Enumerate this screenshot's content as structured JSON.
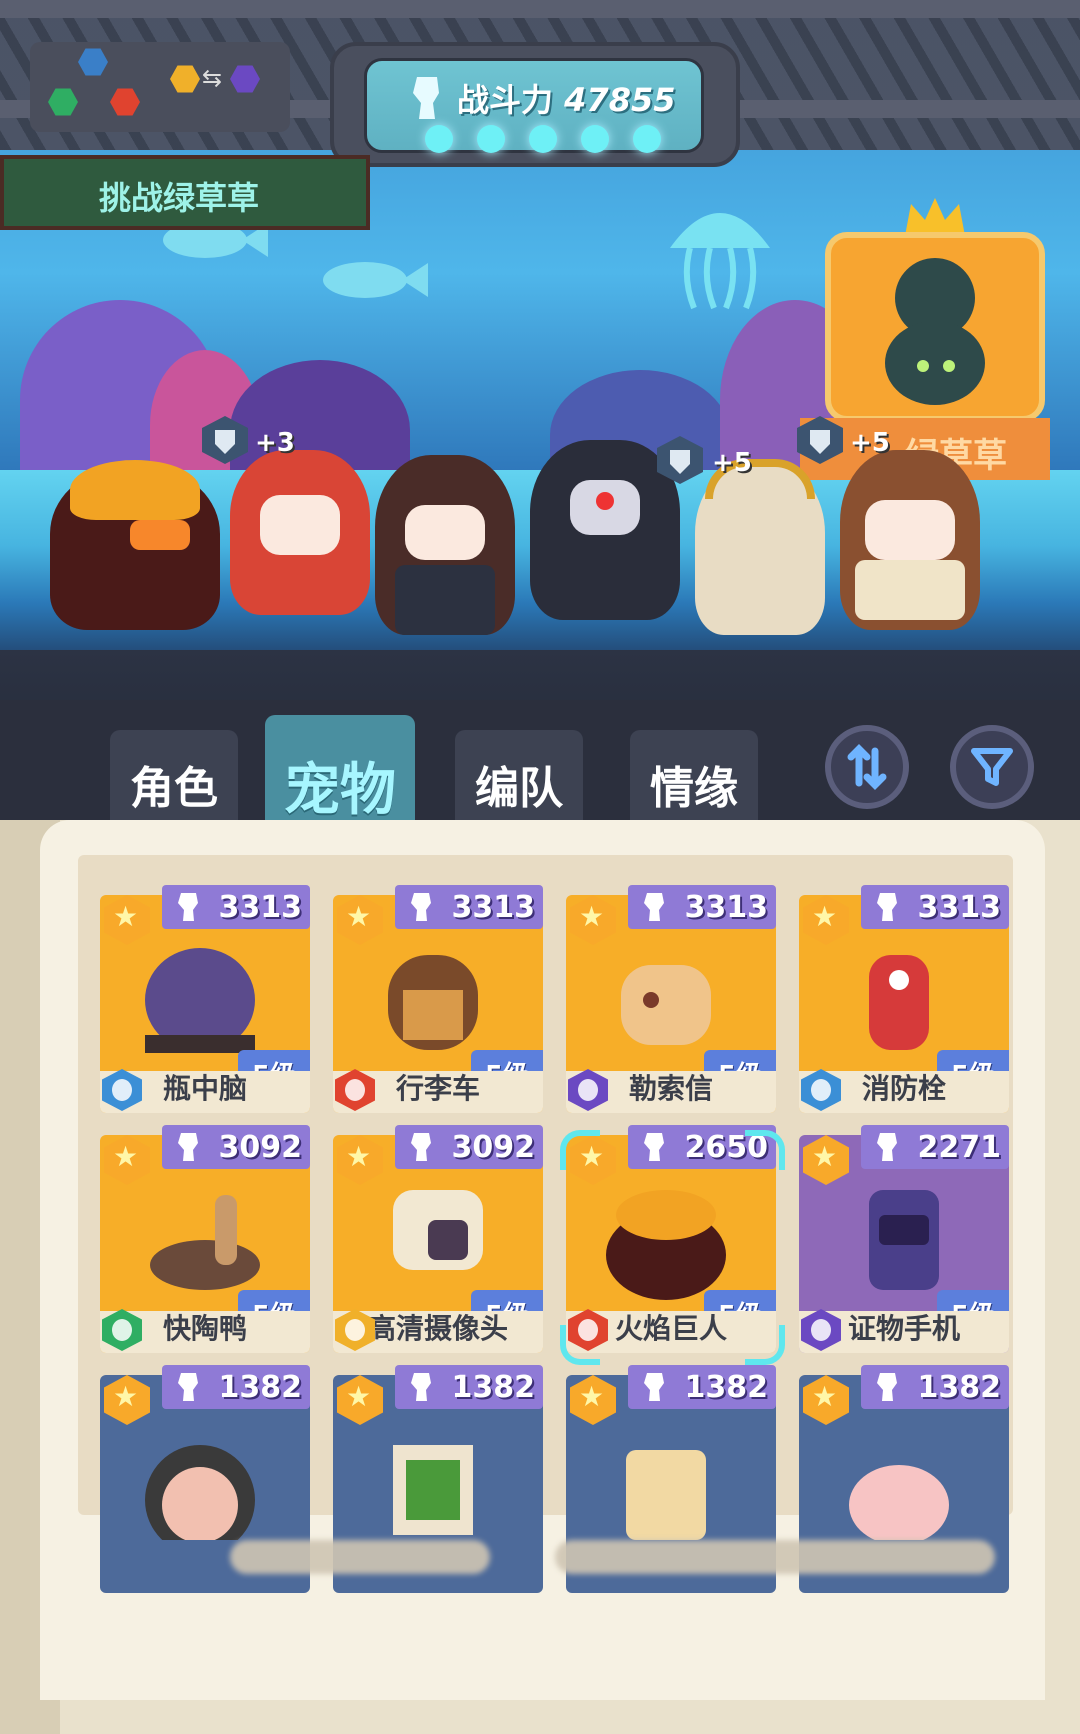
{
  "header": {
    "power_label": "战斗力",
    "power_value": "47855",
    "challenge_label": "挑战绿草草",
    "boss_name_partial": "绿草草",
    "stage_dots": 5
  },
  "team": [
    {
      "name": "fire-golem",
      "bonus": ""
    },
    {
      "name": "red-hair-girl",
      "bonus": "+3"
    },
    {
      "name": "brown-hair-boy",
      "bonus": ""
    },
    {
      "name": "dark-robot",
      "bonus": "+5"
    },
    {
      "name": "laurel-hero",
      "bonus": ""
    },
    {
      "name": "crowned-king",
      "bonus": "+5"
    }
  ],
  "tabs": [
    {
      "label": "角色",
      "active": false
    },
    {
      "label": "宠物",
      "active": true
    },
    {
      "label": "编队",
      "active": false
    },
    {
      "label": "情缘",
      "active": false
    }
  ],
  "buttons": {
    "sort_icon": "sort-icon",
    "filter_icon": "filter-icon"
  },
  "pets": [
    {
      "power": "3313",
      "level": "5级",
      "name": "瓶中脑",
      "element": "water",
      "color": "#3b8fd6"
    },
    {
      "power": "3313",
      "level": "5级",
      "name": "行李车",
      "element": "fire",
      "color": "#e0432f"
    },
    {
      "power": "3313",
      "level": "5级",
      "name": "勒索信",
      "element": "dark",
      "color": "#6b49c2"
    },
    {
      "power": "3313",
      "level": "5级",
      "name": "消防栓",
      "element": "water",
      "color": "#3b8fd6"
    },
    {
      "power": "3092",
      "level": "5级",
      "name": "快陶鸭",
      "element": "grass",
      "color": "#2fae63"
    },
    {
      "power": "3092",
      "level": "5级",
      "name": "高清摄像头",
      "element": "light",
      "color": "#f0b02a"
    },
    {
      "power": "2650",
      "level": "5级",
      "name": "火焰巨人",
      "element": "fire",
      "color": "#e0432f"
    },
    {
      "power": "2271",
      "level": "5级",
      "name": "证物手机",
      "element": "dark",
      "color": "#6b49c2"
    },
    {
      "power": "1382",
      "level": "",
      "name": "",
      "element": "",
      "color": ""
    },
    {
      "power": "1382",
      "level": "",
      "name": "",
      "element": "",
      "color": ""
    },
    {
      "power": "1382",
      "level": "",
      "name": "",
      "element": "",
      "color": ""
    },
    {
      "power": "1382",
      "level": "",
      "name": "",
      "element": "",
      "color": ""
    }
  ],
  "colors": {
    "card_gold": "#f7ae28",
    "power_tag": "#8f7ad6",
    "level_tag": "#5c7fdc",
    "tab_active": "#4a8fa0"
  }
}
